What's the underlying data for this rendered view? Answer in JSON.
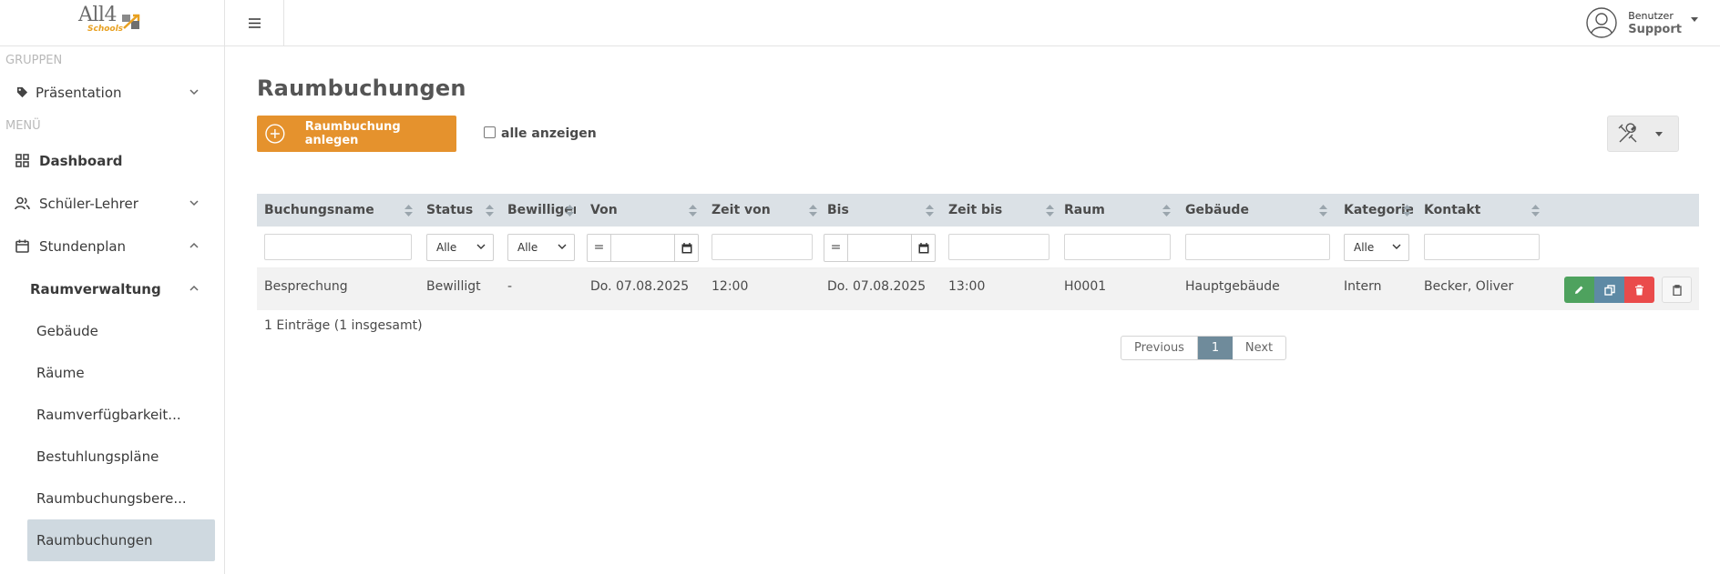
{
  "logo": {
    "main": "All4",
    "sub": "Schools"
  },
  "sidebar": {
    "group_label": "GRUPPEN",
    "menu_label": "MENÜ",
    "group_item": "Präsentation",
    "items": [
      {
        "label": "Dashboard"
      },
      {
        "label": "Schüler-Lehrer"
      },
      {
        "label": "Stundenplan"
      }
    ],
    "submenu": {
      "label": "Raumverwaltung"
    },
    "leaves": [
      {
        "label": "Gebäude"
      },
      {
        "label": "Räume"
      },
      {
        "label": "Raumverfügbarkeit..."
      },
      {
        "label": "Bestuhlungspläne"
      },
      {
        "label": "Raumbuchungsbere..."
      },
      {
        "label": "Raumbuchungen"
      }
    ]
  },
  "user": {
    "line1": "Benutzer",
    "line2": "Support"
  },
  "page": {
    "title": "Raumbuchungen",
    "add_button": "Raumbuchung anlegen",
    "show_all_label": "alle anzeigen"
  },
  "table": {
    "headers": [
      "Buchungsname",
      "Status",
      "Bewilligen",
      "Von",
      "Zeit von",
      "Bis",
      "Zeit bis",
      "Raum",
      "Gebäude",
      "Kategorie",
      "Kontakt"
    ],
    "filters": {
      "status": "Alle",
      "bewilligen": "Alle",
      "kategorie": "Alle",
      "von_op": "=",
      "bis_op": "="
    },
    "rows": [
      {
        "name": "Besprechung",
        "status": "Bewilligt",
        "bewilligen": "-",
        "von": "Do. 07.08.2025",
        "zeit_von": "12:00",
        "bis": "Do. 07.08.2025",
        "zeit_bis": "13:00",
        "raum": "H0001",
        "gebaeude": "Hauptgebäude",
        "kategorie": "Intern",
        "kontakt": "Becker, Oliver"
      }
    ]
  },
  "footer": {
    "count": "1 Einträge (1 insgesamt)"
  },
  "pagination": {
    "prev": "Previous",
    "page": "1",
    "next": "Next"
  },
  "colors": {
    "accent": "#e5922d",
    "edit": "#4ea25e",
    "copy": "#5e8aa5",
    "delete": "#ea4b4b",
    "active_nav": "#cfd9e0",
    "page_active": "#6f8b9b"
  }
}
